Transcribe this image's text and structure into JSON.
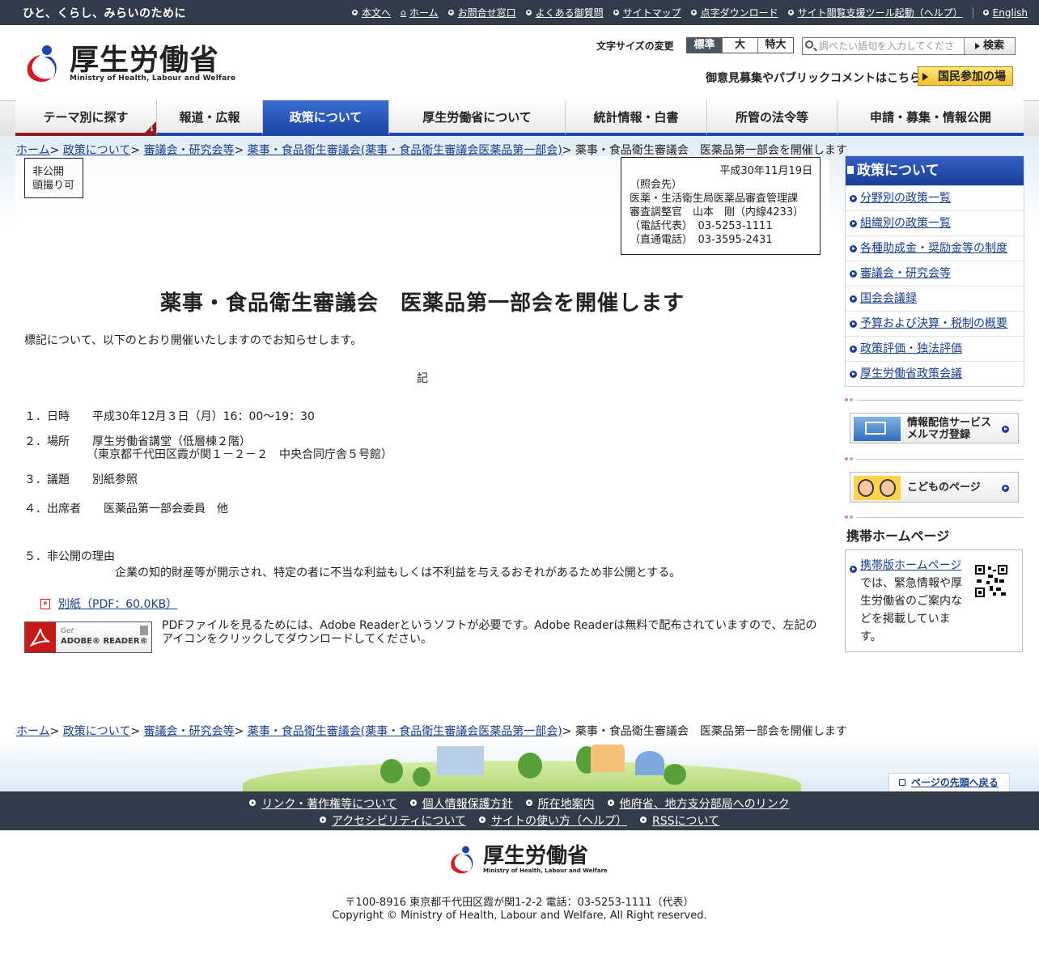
{
  "topbar": {
    "tagline": "ひと、くらし、みらいのために",
    "links": [
      "本文へ",
      "ホーム",
      "お問合せ窓口",
      "よくある御質問",
      "サイトマップ",
      "点字ダウンロード",
      "サイト閲覧支援ツール起動（ヘルプ）"
    ],
    "english": "English"
  },
  "header": {
    "logo_jp": "厚生労働省",
    "logo_en": "Ministry of Health, Labour and Welfare",
    "fontsize_label": "文字サイズの変更",
    "fontsize_options": [
      "標準",
      "大",
      "特大"
    ],
    "search_placeholder": "調べたい語句を入力してください",
    "search_button": "検索",
    "public_comment": "御意見募集やパブリックコメントはこちら",
    "kokumin_button": "国民参加の場"
  },
  "nav": [
    "テーマ別に探す",
    "報道・広報",
    "政策について",
    "厚生労働省について",
    "統計情報・白書",
    "所管の法令等",
    "申請・募集・情報公開"
  ],
  "breadcrumb": {
    "links": [
      "ホーム",
      "政策について",
      "審議会・研究会等",
      "薬事・食品衛生審議会(薬事・食品衛生審議会医薬品第一部会)"
    ],
    "current": "薬事・食品衛生審議会　医薬品第一部会を開催します"
  },
  "status": [
    "非公開",
    "頭撮り可"
  ],
  "contact": {
    "date": "平成30年11月19日",
    "lines": [
      "（照会先）",
      "医薬・生活衛生局医薬品審査管理課",
      "審査調整官　山本　剛（内線4233）",
      "（電話代表）　03-5253-1111",
      "（直通電話）　03-3595-2431"
    ]
  },
  "main": {
    "title": "薬事・食品衛生審議会　医薬品第一部会を開催します",
    "intro": "標記について、以下のとおり開催いたしますのでお知らせします。",
    "ki": "記",
    "items": [
      "１．日時　　平成30年12月３日（月）16：00～19：30",
      "２．場所　　厚生労働省講堂（低層棟２階）",
      "　　　　　　（東京都千代田区霞が関１－２－２　中央合同庁舎５号館）",
      "３．議題　　別紙参照",
      "４．出席者　　医薬品第一部会委員　他",
      "５．非公開の理由",
      "　　　　　　　　企業の知的財産等が開示され、特定の者に不当な利益もしくは不利益を与えるおそれがあるため非公開とする。"
    ],
    "pdf_link": "別紙（PDF：60.0KB）",
    "adobe_get": "Get",
    "adobe_name": "ADOBE® READER®",
    "adobe_note": "PDFファイルを見るためには、Adobe Readerというソフトが必要です。Adobe Readerは無料で配布されていますので、左記のアイコンをクリックしてダウンロードしてください。"
  },
  "sidebar": {
    "title": "政策について",
    "items": [
      "分野別の政策一覧",
      "組織別の政策一覧",
      "各種助成金・奨励金等の制度",
      "審議会・研究会等",
      "国会会議録",
      "予算および決算・税制の概要",
      "政策評価・独法評価",
      "厚生労働省政策会議"
    ],
    "mail_banner": [
      "情報配信サービス",
      "メルマガ登録"
    ],
    "kids_banner": "こどものページ",
    "mobile_heading": "携帯ホームページ",
    "mobile_link": "携帯版ホームページ",
    "mobile_text": "では、緊急情報や厚生労働省のご案内などを掲載しています。"
  },
  "footer": {
    "page_top": "ページの先頭へ戻る",
    "row1": [
      "リンク・著作権等について",
      "個人情報保護方針",
      "所在地案内",
      "他府省、地方支分部局へのリンク"
    ],
    "row2": [
      "アクセシビリティについて",
      "サイトの使い方（ヘルプ）",
      "RSSについて"
    ],
    "logo_jp": "厚生労働省",
    "logo_en": "Ministry of Health, Labour and Welfare",
    "address": "〒100-8916 東京都千代田区霞が関1-2-2 電話：03-5253-1111（代表）",
    "copyright": "Copyright © Ministry of Health, Labour and Welfare, All Right reserved."
  },
  "colors": {
    "topbar": "#323b4a",
    "nav_accent": "#8e1c28",
    "nav_active": "#1d46a8",
    "link": "#1a3f8f"
  }
}
